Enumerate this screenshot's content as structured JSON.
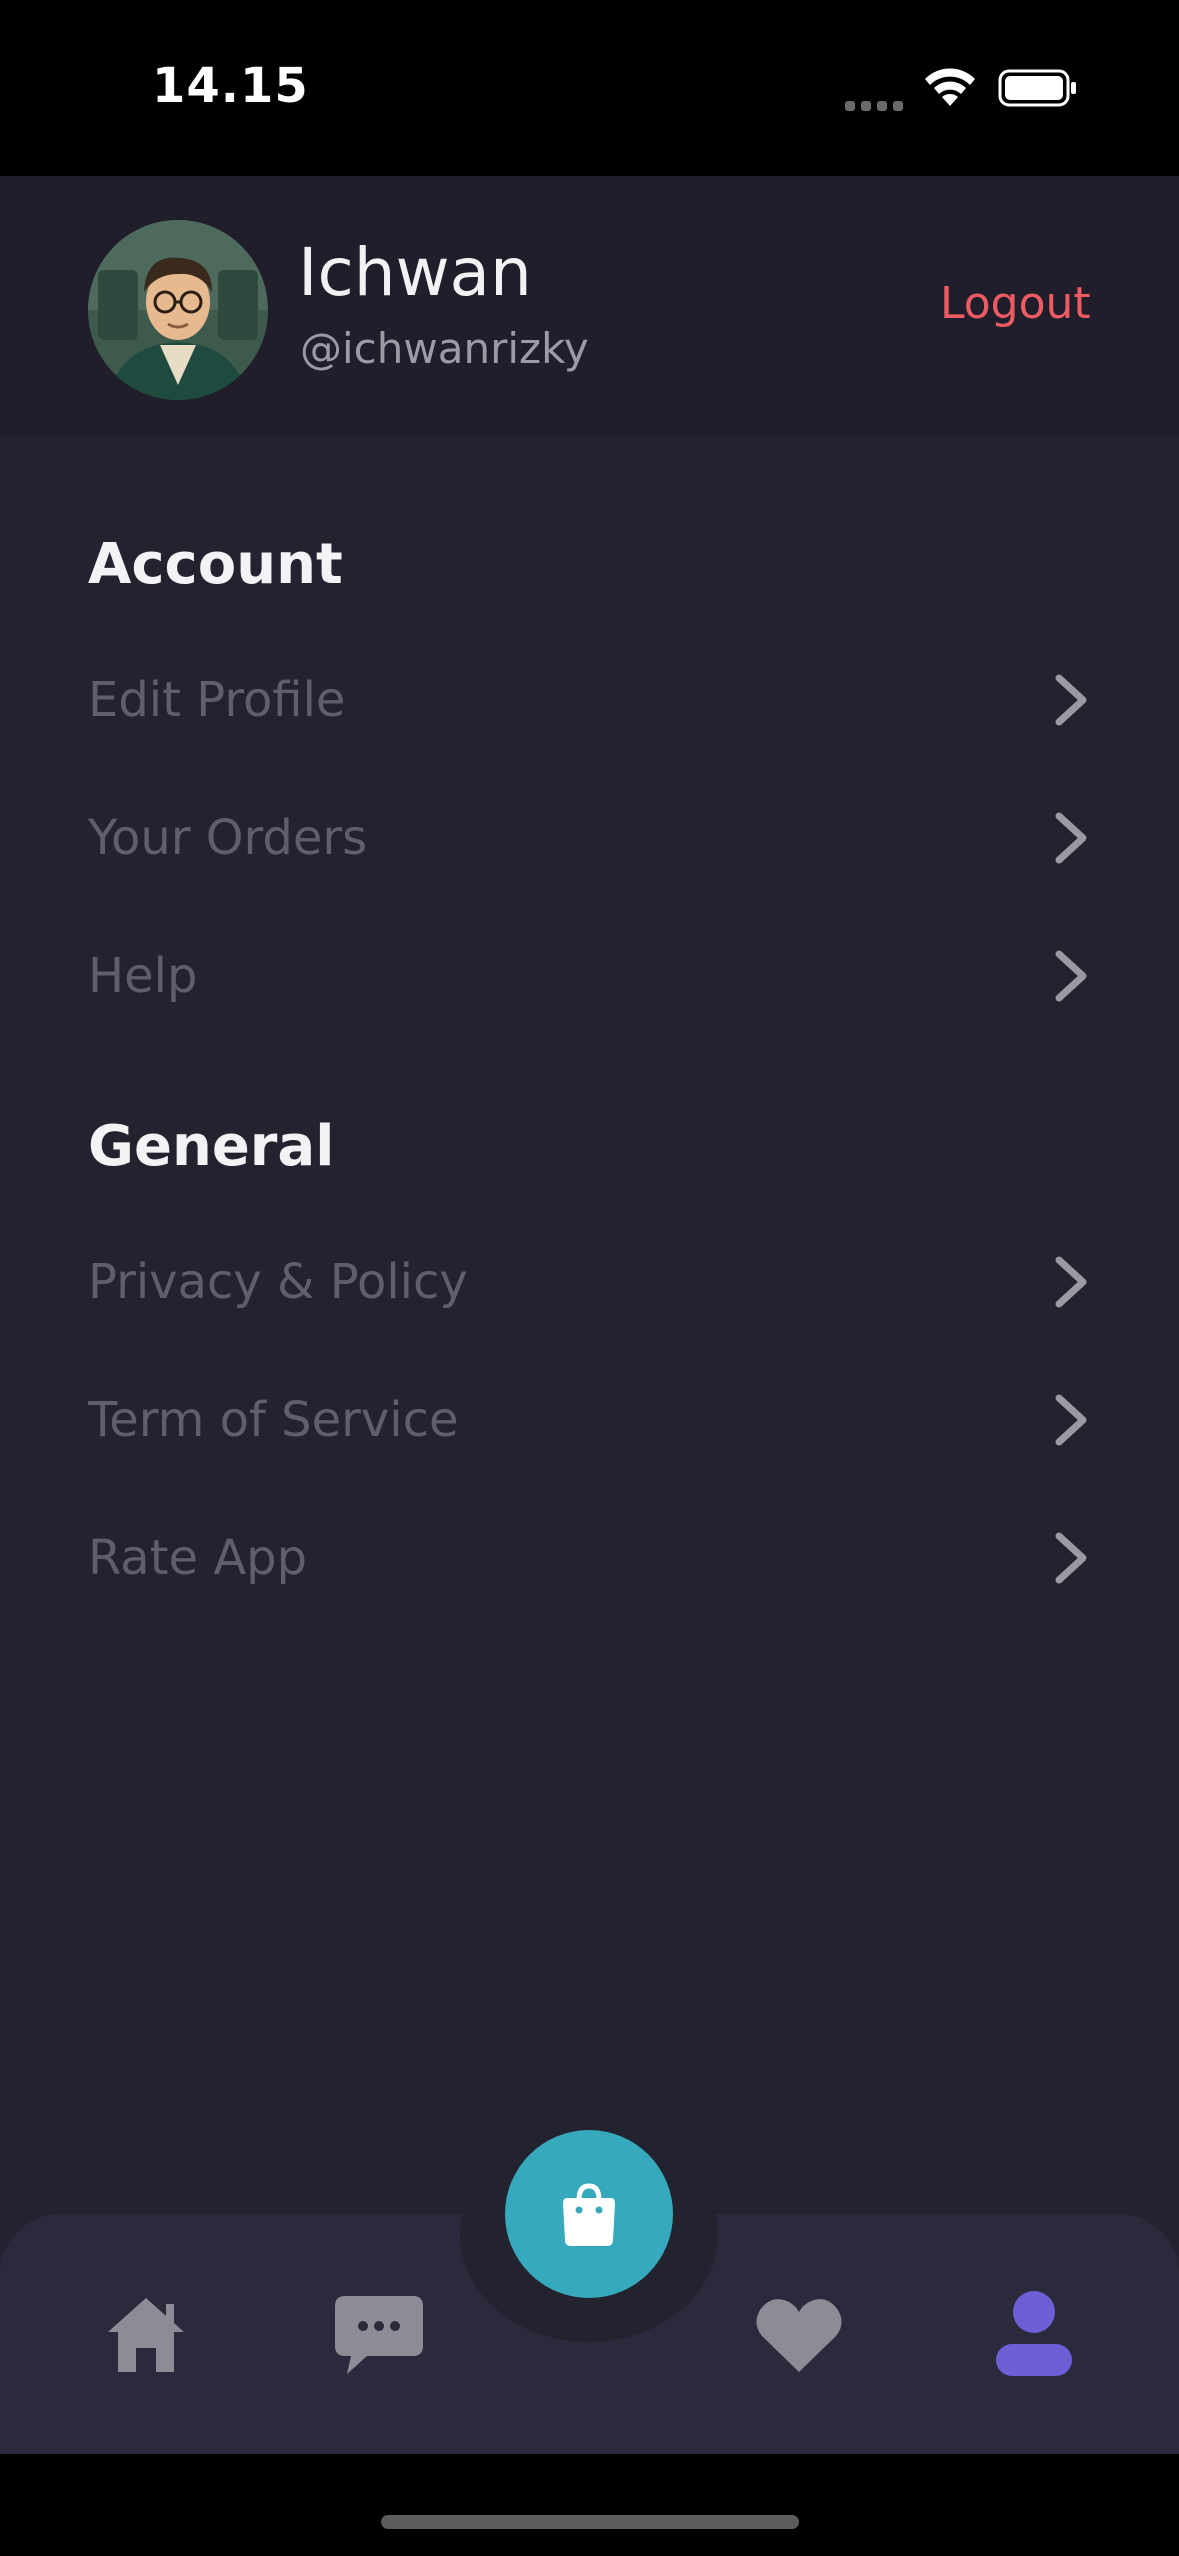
{
  "status": {
    "time": "14.15"
  },
  "profile": {
    "name": "Ichwan",
    "username": "@ichwanrizky",
    "logout_label": "Logout"
  },
  "account": {
    "title": "Account",
    "items": [
      {
        "label": "Edit Profile"
      },
      {
        "label": "Your Orders"
      },
      {
        "label": "Help"
      }
    ]
  },
  "general": {
    "title": "General",
    "items": [
      {
        "label": "Privacy & Policy"
      },
      {
        "label": "Term of Service"
      },
      {
        "label": "Rate App"
      }
    ]
  },
  "nav": {
    "items": [
      "home-icon",
      "chat-icon",
      "shopping-bag-icon",
      "heart-icon",
      "profile-icon"
    ],
    "active": "profile-icon",
    "active_color": "#6f5fd6",
    "inactive_color": "#8c8b96",
    "fab_color": "#36a9bd"
  },
  "colors": {
    "background": "#23222f",
    "header": "#1f1e2a",
    "logout": "#ef5b63"
  }
}
